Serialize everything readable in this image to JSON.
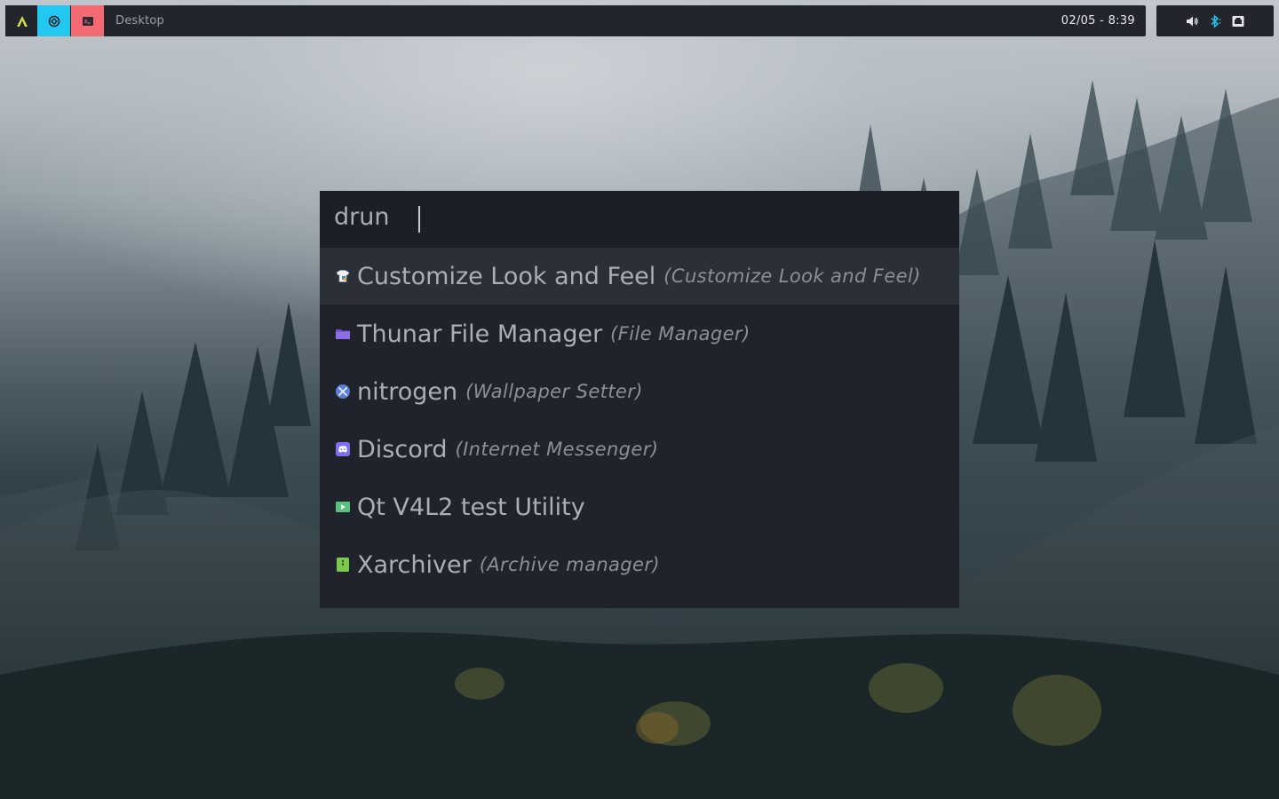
{
  "topbar": {
    "workspace_label": "Desktop",
    "clock": "02/05 -  8:39",
    "colors": {
      "bar_bg": "#22252b",
      "ws_active": "#22c8f0",
      "ws_terminal": "#f46a72",
      "logo": "#d6e04a"
    },
    "tray_icons": [
      "volume-icon",
      "bluetooth-icon",
      "network-icon"
    ]
  },
  "launcher": {
    "mode_prompt": "drun",
    "query": "",
    "entries": [
      {
        "name": "Customize Look and Feel",
        "generic": "(Customize Look and Feel)",
        "icon": "appearance-icon",
        "selected": true
      },
      {
        "name": "Thunar File Manager",
        "generic": "(File Manager)",
        "icon": "folder-icon",
        "selected": false
      },
      {
        "name": "nitrogen",
        "generic": "(Wallpaper Setter)",
        "icon": "nitrogen-icon",
        "selected": false
      },
      {
        "name": "Discord",
        "generic": "(Internet Messenger)",
        "icon": "discord-icon",
        "selected": false
      },
      {
        "name": "Qt V4L2 test Utility",
        "generic": "",
        "icon": "video-icon",
        "selected": false
      },
      {
        "name": "Xarchiver",
        "generic": "(Archive manager)",
        "icon": "archive-icon",
        "selected": false
      }
    ]
  }
}
